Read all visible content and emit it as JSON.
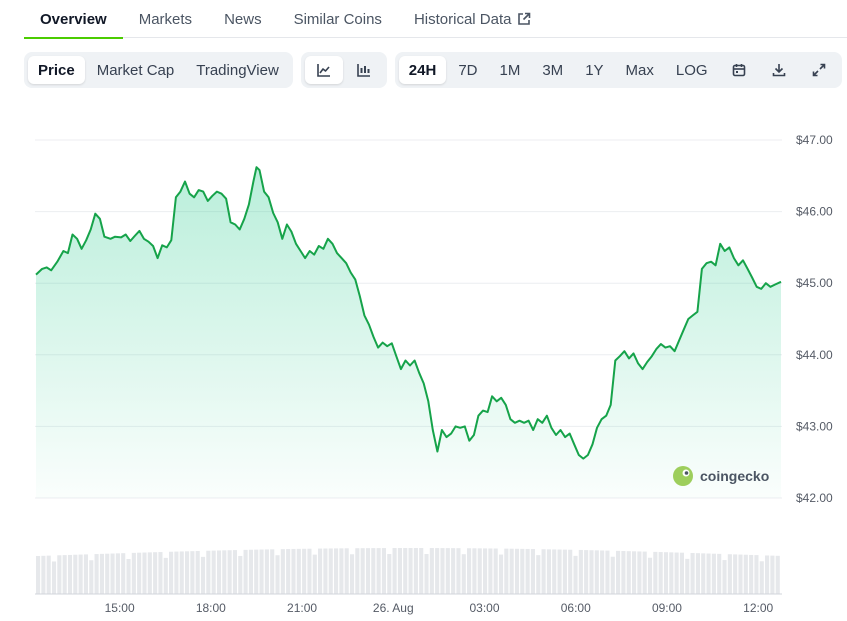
{
  "tabs": [
    {
      "label": "Overview",
      "active": true
    },
    {
      "label": "Markets"
    },
    {
      "label": "News"
    },
    {
      "label": "Similar Coins"
    },
    {
      "label": "Historical Data",
      "external": true
    }
  ],
  "toolbar": {
    "view_tabs": [
      "Price",
      "Market Cap",
      "TradingView"
    ],
    "selected_view": "Price",
    "chart_icons": [
      "line-chart-icon",
      "candlestick-chart-icon"
    ],
    "ranges": [
      "24H",
      "7D",
      "1M",
      "3M",
      "1Y",
      "Max",
      "LOG"
    ],
    "selected_range": "24H",
    "tool_icons": [
      "calendar-icon",
      "download-icon",
      "fullscreen-icon"
    ]
  },
  "watermark": "coingecko",
  "colors": {
    "line": "#16a34a",
    "fill_top": "#16c784",
    "accent_tab": "#4bcc00",
    "volume": "#e6e8eb"
  },
  "chart_data": {
    "type": "area",
    "x_axis_labels": [
      "15:00",
      "18:00",
      "21:00",
      "26. Aug",
      "03:00",
      "06:00",
      "09:00",
      "12:00"
    ],
    "y_axis_labels": [
      "$47.00",
      "$46.00",
      "$45.00",
      "$44.00",
      "$43.00",
      "$42.00"
    ],
    "ylim": [
      42.0,
      47.0
    ],
    "x_unit": "hours from 12:15 on 25 Aug",
    "xlim": [
      0,
      24.5
    ],
    "grid": true,
    "series": [
      {
        "values": [
          [
            0.0,
            45.12
          ],
          [
            0.2,
            45.2
          ],
          [
            0.35,
            45.22
          ],
          [
            0.5,
            45.18
          ],
          [
            0.7,
            45.3
          ],
          [
            0.9,
            45.45
          ],
          [
            1.05,
            45.42
          ],
          [
            1.2,
            45.68
          ],
          [
            1.35,
            45.62
          ],
          [
            1.5,
            45.48
          ],
          [
            1.65,
            45.6
          ],
          [
            1.8,
            45.75
          ],
          [
            1.95,
            45.97
          ],
          [
            2.1,
            45.9
          ],
          [
            2.25,
            45.65
          ],
          [
            2.45,
            45.62
          ],
          [
            2.6,
            45.65
          ],
          [
            2.8,
            45.64
          ],
          [
            2.95,
            45.68
          ],
          [
            3.1,
            45.59
          ],
          [
            3.25,
            45.66
          ],
          [
            3.4,
            45.73
          ],
          [
            3.55,
            45.62
          ],
          [
            3.7,
            45.58
          ],
          [
            3.85,
            45.52
          ],
          [
            4.0,
            45.35
          ],
          [
            4.15,
            45.53
          ],
          [
            4.3,
            45.5
          ],
          [
            4.45,
            45.6
          ],
          [
            4.6,
            46.2
          ],
          [
            4.75,
            46.28
          ],
          [
            4.9,
            46.42
          ],
          [
            5.05,
            46.25
          ],
          [
            5.2,
            46.2
          ],
          [
            5.35,
            46.3
          ],
          [
            5.5,
            46.28
          ],
          [
            5.65,
            46.15
          ],
          [
            5.8,
            46.22
          ],
          [
            5.95,
            46.28
          ],
          [
            6.1,
            46.25
          ],
          [
            6.25,
            46.18
          ],
          [
            6.4,
            45.85
          ],
          [
            6.55,
            45.82
          ],
          [
            6.7,
            45.75
          ],
          [
            6.85,
            45.9
          ],
          [
            7.0,
            46.1
          ],
          [
            7.15,
            46.42
          ],
          [
            7.25,
            46.62
          ],
          [
            7.35,
            46.58
          ],
          [
            7.5,
            46.28
          ],
          [
            7.65,
            46.2
          ],
          [
            7.8,
            45.98
          ],
          [
            7.95,
            45.85
          ],
          [
            8.1,
            45.62
          ],
          [
            8.25,
            45.82
          ],
          [
            8.4,
            45.72
          ],
          [
            8.55,
            45.55
          ],
          [
            8.7,
            45.45
          ],
          [
            8.85,
            45.35
          ],
          [
            9.0,
            45.45
          ],
          [
            9.15,
            45.4
          ],
          [
            9.3,
            45.52
          ],
          [
            9.45,
            45.48
          ],
          [
            9.6,
            45.62
          ],
          [
            9.75,
            45.55
          ],
          [
            9.9,
            45.42
          ],
          [
            10.05,
            45.35
          ],
          [
            10.2,
            45.28
          ],
          [
            10.35,
            45.15
          ],
          [
            10.5,
            45.05
          ],
          [
            10.65,
            44.82
          ],
          [
            10.8,
            44.55
          ],
          [
            10.95,
            44.42
          ],
          [
            11.1,
            44.25
          ],
          [
            11.25,
            44.1
          ],
          [
            11.4,
            44.17
          ],
          [
            11.55,
            44.12
          ],
          [
            11.7,
            44.16
          ],
          [
            11.85,
            43.98
          ],
          [
            12.0,
            43.8
          ],
          [
            12.15,
            43.92
          ],
          [
            12.3,
            43.85
          ],
          [
            12.45,
            43.92
          ],
          [
            12.6,
            43.75
          ],
          [
            12.75,
            43.6
          ],
          [
            12.9,
            43.35
          ],
          [
            13.05,
            42.95
          ],
          [
            13.2,
            42.65
          ],
          [
            13.35,
            42.95
          ],
          [
            13.5,
            42.85
          ],
          [
            13.65,
            42.9
          ],
          [
            13.8,
            43.0
          ],
          [
            13.95,
            42.98
          ],
          [
            14.1,
            43.0
          ],
          [
            14.25,
            42.8
          ],
          [
            14.4,
            42.88
          ],
          [
            14.55,
            43.15
          ],
          [
            14.7,
            43.22
          ],
          [
            14.85,
            43.2
          ],
          [
            15.0,
            43.42
          ],
          [
            15.15,
            43.35
          ],
          [
            15.3,
            43.4
          ],
          [
            15.45,
            43.3
          ],
          [
            15.6,
            43.1
          ],
          [
            15.75,
            43.05
          ],
          [
            15.9,
            43.08
          ],
          [
            16.05,
            43.05
          ],
          [
            16.2,
            43.08
          ],
          [
            16.35,
            42.95
          ],
          [
            16.5,
            43.1
          ],
          [
            16.65,
            43.05
          ],
          [
            16.8,
            43.15
          ],
          [
            16.95,
            42.98
          ],
          [
            17.1,
            42.88
          ],
          [
            17.25,
            42.95
          ],
          [
            17.4,
            42.85
          ],
          [
            17.55,
            42.9
          ],
          [
            17.7,
            42.75
          ],
          [
            17.85,
            42.6
          ],
          [
            18.0,
            42.55
          ],
          [
            18.15,
            42.6
          ],
          [
            18.3,
            42.75
          ],
          [
            18.45,
            42.98
          ],
          [
            18.6,
            43.1
          ],
          [
            18.75,
            43.15
          ],
          [
            18.9,
            43.3
          ],
          [
            19.05,
            43.92
          ],
          [
            19.2,
            43.98
          ],
          [
            19.35,
            44.05
          ],
          [
            19.5,
            43.95
          ],
          [
            19.65,
            44.02
          ],
          [
            19.8,
            43.88
          ],
          [
            19.95,
            43.8
          ],
          [
            20.1,
            43.9
          ],
          [
            20.25,
            43.98
          ],
          [
            20.4,
            44.08
          ],
          [
            20.55,
            44.15
          ],
          [
            20.7,
            44.1
          ],
          [
            20.85,
            44.12
          ],
          [
            21.0,
            44.05
          ],
          [
            21.15,
            44.2
          ],
          [
            21.3,
            44.35
          ],
          [
            21.45,
            44.5
          ],
          [
            21.6,
            44.55
          ],
          [
            21.75,
            44.6
          ],
          [
            21.9,
            45.2
          ],
          [
            22.05,
            45.28
          ],
          [
            22.2,
            45.3
          ],
          [
            22.35,
            45.25
          ],
          [
            22.5,
            45.55
          ],
          [
            22.65,
            45.45
          ],
          [
            22.8,
            45.5
          ],
          [
            22.95,
            45.35
          ],
          [
            23.1,
            45.25
          ],
          [
            23.25,
            45.32
          ],
          [
            23.4,
            45.2
          ],
          [
            23.55,
            45.08
          ],
          [
            23.7,
            44.95
          ],
          [
            23.85,
            44.92
          ],
          [
            24.0,
            45.0
          ],
          [
            24.15,
            44.95
          ],
          [
            24.3,
            44.98
          ],
          [
            24.5,
            45.02
          ]
        ]
      }
    ],
    "volume_bars": 140
  }
}
